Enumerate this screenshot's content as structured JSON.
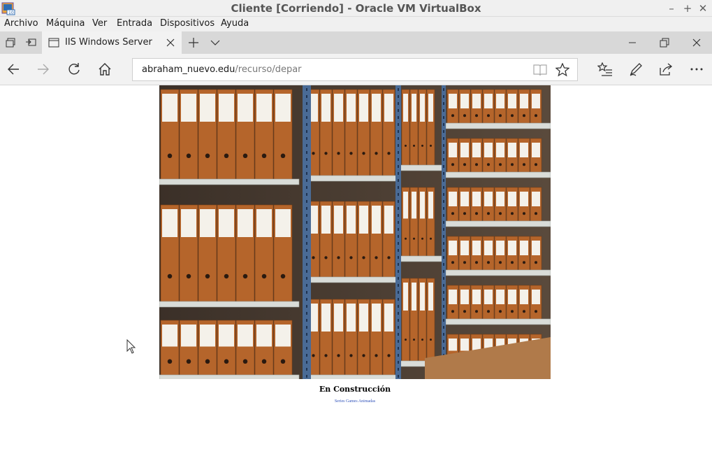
{
  "vbox": {
    "title": "Cliente [Corriendo] - Oracle VM VirtualBox",
    "controls": {
      "minimize": "–",
      "maximize": "+",
      "close": "✕"
    },
    "menu": [
      "Archivo",
      "Máquina",
      "Ver",
      "Entrada",
      "Dispositivos",
      "Ayuda"
    ]
  },
  "browser": {
    "tab": {
      "title": "IIS Windows Server"
    },
    "address": {
      "host": "abraham_nuevo.edu",
      "path": "/recurso/depar"
    }
  },
  "page": {
    "heading": "En Construcción",
    "subtitle": "Series Games Animadas"
  },
  "colors": {
    "shelf_metal": "#4a6b96",
    "box_orange": "#b5652b",
    "link_blue": "#3355bb"
  },
  "icons": [
    "virtualbox-app-icon",
    "tab-preview-icon",
    "set-aside-tabs-icon",
    "page-icon",
    "tab-close-icon",
    "new-tab-icon",
    "tab-list-chevron-icon",
    "back-arrow-icon",
    "forward-arrow-icon",
    "refresh-icon",
    "home-icon",
    "reading-view-icon",
    "favorite-star-icon",
    "favorites-hub-icon",
    "web-note-icon",
    "share-icon",
    "more-dots-icon",
    "mouse-cursor-icon"
  ]
}
